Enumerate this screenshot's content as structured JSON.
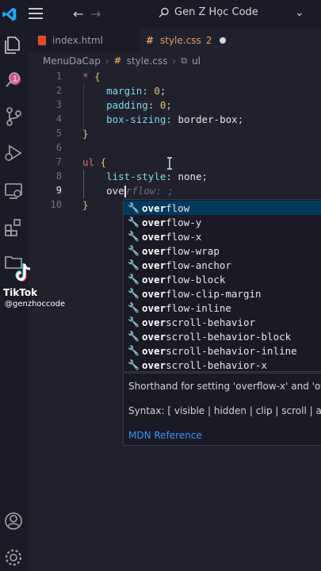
{
  "titlebar": {
    "search_text": "Gen Z Học Code"
  },
  "activity": {
    "badge_count": "1"
  },
  "tabs": [
    {
      "label": "index.html"
    },
    {
      "label": "style.css",
      "problems": "2"
    }
  ],
  "breadcrumb": {
    "folder": "MenuDaCap",
    "file": "style.css",
    "symbol": "ul"
  },
  "editor": {
    "line_numbers": [
      "1",
      "2",
      "3",
      "4",
      "5",
      "6",
      "7",
      "8",
      "9",
      "10"
    ],
    "active_line": "9",
    "lines": {
      "l1_selector": "*",
      "l1_brace": "{",
      "l2_prop": "margin",
      "l2_val": "0",
      "l3_prop": "padding",
      "l3_val": "0",
      "l4_prop": "box-sizing",
      "l4_val": "border-box",
      "l5_brace": "}",
      "l7_selector": "ul",
      "l7_brace": "{",
      "l8_prop": "list-style",
      "l8_val": "none",
      "l9_typed": "ove",
      "l9_ghost": "rflow: ;",
      "l10_brace": "}"
    }
  },
  "suggestions": {
    "items": [
      {
        "match": "over",
        "rest": "flow"
      },
      {
        "match": "over",
        "rest": "flow-y"
      },
      {
        "match": "over",
        "rest": "flow-x"
      },
      {
        "match": "over",
        "rest": "flow-wrap"
      },
      {
        "match": "over",
        "rest": "flow-anchor"
      },
      {
        "match": "over",
        "rest": "flow-block"
      },
      {
        "match": "over",
        "rest": "flow-clip-margin"
      },
      {
        "match": "over",
        "rest": "flow-inline"
      },
      {
        "match": "over",
        "rest": "scroll-behavior"
      },
      {
        "match": "over",
        "rest": "scroll-behavior-block"
      },
      {
        "match": "over",
        "rest": "scroll-behavior-inline"
      },
      {
        "match": "over",
        "rest": "scroll-behavior-x"
      }
    ],
    "selected_index": 0,
    "detail": {
      "description": "Shorthand for setting 'overflow-x' and 'ov",
      "syntax": "Syntax: [ visible | hidden | clip | scroll | auto",
      "reference": "MDN Reference"
    }
  },
  "watermark": {
    "brand": "TikTok",
    "handle": "@genzhoccode"
  },
  "colors": {
    "accent": "#3794ff",
    "modified_tab": "#e89b64",
    "badge": "#e04a8b"
  }
}
